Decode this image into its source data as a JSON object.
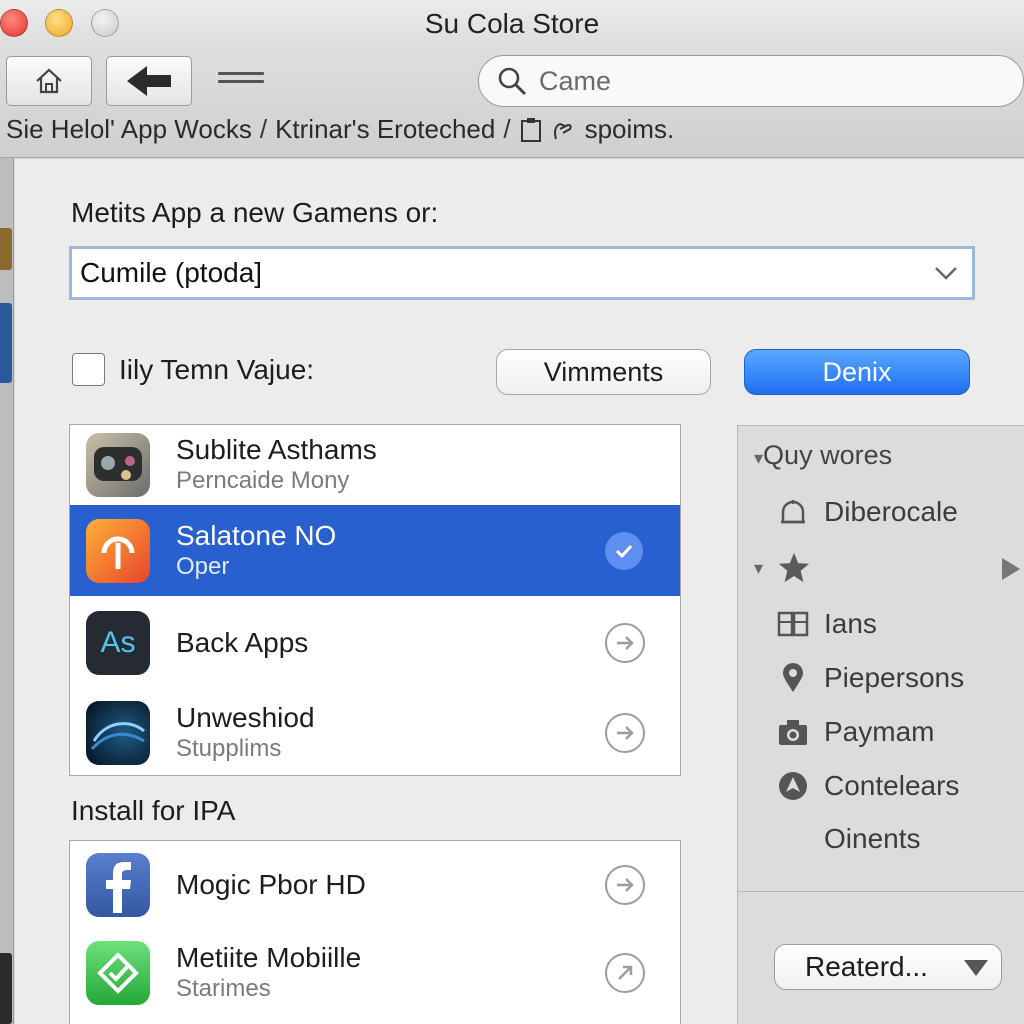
{
  "window": {
    "title": "Su Cola Store"
  },
  "toolbar": {
    "search_placeholder": "Came",
    "breadcrumb": [
      "Sie Helol' App Wocks",
      "Ktrinar's Eroteched",
      "spoims."
    ]
  },
  "main": {
    "prompt": "Metits App a new Gamens or:",
    "combo_value": "Cumile (ptoda]",
    "checkbox_label": "Iily Temn Vajue:",
    "secondary_button": "Vimments",
    "primary_button": "Denix",
    "apps": [
      {
        "name": "Sublite Asthams",
        "subtitle": "Perncaide Mony"
      },
      {
        "name": "Salatone NO",
        "subtitle": "Oper",
        "selected": true
      },
      {
        "name": "Back Apps",
        "subtitle": ""
      },
      {
        "name": "Unweshiod",
        "subtitle": "Stupplims"
      }
    ],
    "section_title": "Install for IPA",
    "install_apps": [
      {
        "name": "Mogic Pbor HD",
        "subtitle": ""
      },
      {
        "name": "Metiite Mobiille",
        "subtitle": "Starimes"
      }
    ]
  },
  "sidebar": {
    "header": "Quy wores",
    "items": [
      {
        "label": "Diberocale",
        "icon": "bell-icon"
      },
      {
        "label": "",
        "icon": "star-icon"
      },
      {
        "label": "Ians",
        "icon": "book-icon"
      },
      {
        "label": "Piepersons",
        "icon": "pin-icon"
      },
      {
        "label": "Paymam",
        "icon": "camera-icon"
      },
      {
        "label": "Contelears",
        "icon": "compass-icon"
      },
      {
        "label": "Oinents",
        "icon": ""
      }
    ],
    "sort_button": "Reaterd..."
  },
  "colors": {
    "selection": "#2860cf",
    "primary_button": "#1e6ff0"
  }
}
